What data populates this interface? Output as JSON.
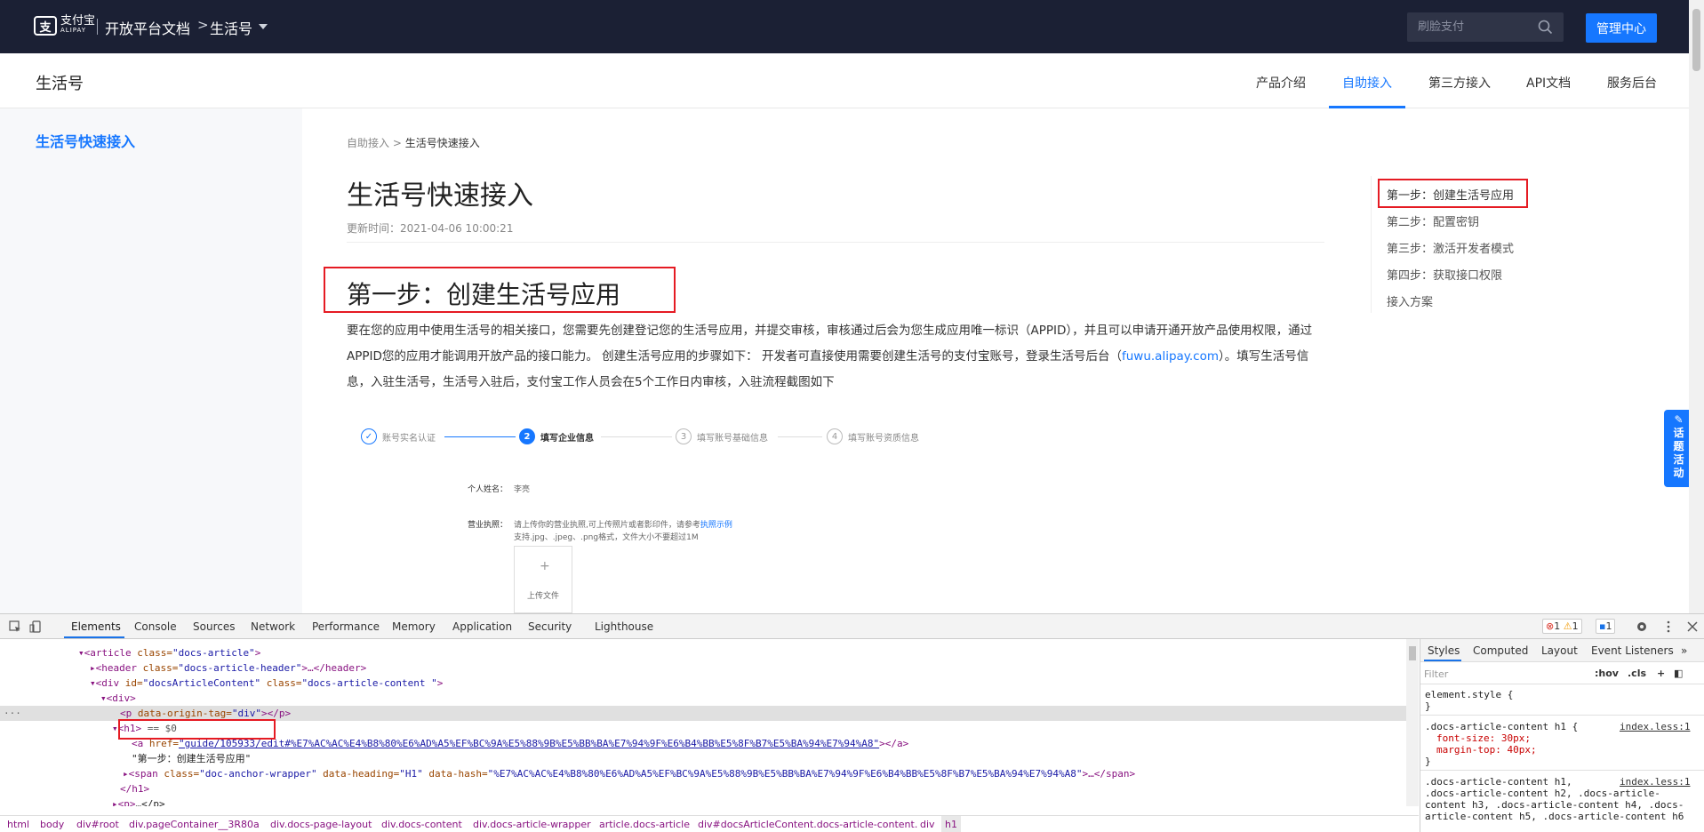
{
  "topbar": {
    "logo_cn": "支付宝",
    "logo_en": "ALIPAY",
    "title": "开放平台文档",
    "separator": ">",
    "product": "生活号",
    "search_placeholder": "刷脸支付",
    "admin_button": "管理中心"
  },
  "subnav": {
    "title": "生活号",
    "tabs": [
      {
        "label": "产品介绍"
      },
      {
        "label": "自助接入"
      },
      {
        "label": "第三方接入"
      },
      {
        "label": "API文档"
      },
      {
        "label": "服务后台"
      }
    ],
    "active_tab": "自助接入"
  },
  "sidebar": {
    "items": [
      {
        "label": "生活号快速接入"
      }
    ]
  },
  "breadcrumb": {
    "parent": "自助接入",
    "sep": ">",
    "current": "生活号快速接入"
  },
  "article": {
    "title": "生活号快速接入",
    "updated": "更新时间：2021-04-06 10:00:21",
    "h1": "第一步：创建生活号应用",
    "para_1": "要在您的应用中使用生活号的相关接口，您需要先创建登记您的生活号应用，并提交审核，审核通过后会为您生成应用唯一标识（APPID），并且可以申请开通开放产品使用权限，通过APPID您的应用才能调用开放产品的接口能力。 创建生活号应用的步骤如下： 开发者可直接使用需要创建生活号的支付宝账号，登录生活号后台（",
    "link": "fuwu.alipay.com",
    "para_2": "）。填写生活号信息，入驻生活号，生活号入驻后，支付宝工作人员会在5个工作日内审核，入驻流程截图如下"
  },
  "embedded_steps": {
    "steps": [
      {
        "num": "✓",
        "label": "账号实名认证"
      },
      {
        "num": "2",
        "label": "填写企业信息"
      },
      {
        "num": "3",
        "label": "填写账号基础信息"
      },
      {
        "num": "4",
        "label": "填写账号资质信息"
      }
    ],
    "name_label": "个人姓名：",
    "name_value": "李亮",
    "license_label": "营业执照：",
    "license_hint": "请上传你的营业执照,可上传照片或者影印件，请参考",
    "license_link": "执照示例",
    "license_formats": "支持.jpg、.jpeg、.png格式，文件大小不要超过1M",
    "upload_plus": "+",
    "upload_label": "上传文件"
  },
  "toc": {
    "items": [
      {
        "label": "第一步：创建生活号应用"
      },
      {
        "label": "第二步：配置密钥"
      },
      {
        "label": "第三步：激活开发者模式"
      },
      {
        "label": "第四步：获取接口权限"
      },
      {
        "label": "接入方案"
      }
    ]
  },
  "float_button": {
    "label": "话题活动"
  },
  "devtools": {
    "tabs": [
      {
        "label": "Elements"
      },
      {
        "label": "Console"
      },
      {
        "label": "Sources"
      },
      {
        "label": "Network"
      },
      {
        "label": "Performance"
      },
      {
        "label": "Memory"
      },
      {
        "label": "Application"
      },
      {
        "label": "Security"
      },
      {
        "label": "Lighthouse"
      }
    ],
    "errors": "1",
    "warnings": "1",
    "messages": "1",
    "dom": {
      "l1_tag": "<article",
      "l1_attr": " class=",
      "l1_val": "\"docs-article\"",
      "l2_tag": "<header",
      "l2_attr": " class=",
      "l2_val": "\"docs-article-header\"",
      "l2_tail": ">…</header>",
      "l3_tag": "<div",
      "l3_attr1": " id=",
      "l3_val1": "\"docsArticleContent\"",
      "l3_attr2": " class=",
      "l3_val2": "\"docs-article-content \"",
      "l4": "<div>",
      "l5_tag": "<p",
      "l5_attr": " data-origin-tag=",
      "l5_val": "\"div\"",
      "l5_tail": "></p>",
      "l6_tag": "<h1>",
      "l6_eq": " == $0",
      "l7_tag": "<a",
      "l7_attr": " href=",
      "l7_val": "\"guide/105933/edit#%E7%AC%AC%E4%B8%80%E6%AD%A5%EF%BC%9A%E5%88%9B%E5%BB%BA%E7%94%9F%E6%B4%BB%E5%8F%B7%E5%BA%94%E7%94%A8\"",
      "l7_tail": "></a>",
      "l8_text": "\"第一步：创建生活号应用\"",
      "l9_tag": "<span",
      "l9_attr1": " class=",
      "l9_val1": "\"doc-anchor-wrapper\"",
      "l9_attr2": " data-heading=",
      "l9_val2": "\"H1\"",
      "l9_attr3": " data-hash=",
      "l9_val3": "\"%E7%AC%AC%E4%B8%80%E6%AD%A5%EF%BC%9A%E5%88%9B%E5%BB%BA%E7%94%9F%E6%B4%BB%E5%8F%B7%E5%BA%94%E7%94%A8\"",
      "l9_tail": ">…</span>",
      "l10": "</h1>",
      "l11_tag": "<p>",
      "l11_tail": "…</p>"
    },
    "crumbs": [
      {
        "label": "html"
      },
      {
        "label": "body"
      },
      {
        "label": "div#root"
      },
      {
        "label": "div.pageContainer__3R80a"
      },
      {
        "label": "div.docs-page-layout"
      },
      {
        "label": "div.docs-content"
      },
      {
        "label": "div.docs-article-wrapper"
      },
      {
        "label": "article.docs-article"
      },
      {
        "label": "div#docsArticleContent.docs-article-content."
      },
      {
        "label": "div"
      },
      {
        "label": "h1"
      }
    ],
    "styles_tabs": [
      {
        "label": "Styles"
      },
      {
        "label": "Computed"
      },
      {
        "label": "Layout"
      },
      {
        "label": "Event Listeners"
      }
    ],
    "filter_placeholder": "Filter",
    "hov": ":hov",
    "cls": ".cls",
    "styles": {
      "element_style": "element.style {",
      "close1": "}",
      "rule1_sel": ".docs-article-content h1 {",
      "rule1_link": "index.less:1",
      "rule1_p1": "font-size: 30px;",
      "rule1_p2": "margin-top: 40px;",
      "close2": "}",
      "rule2_l1": ".docs-article-content h1,",
      "rule2_link": "index.less:1",
      "rule2_l2": ".docs-article-content h2, .docs-article-",
      "rule2_l3": "content h3, .docs-article-content h4, .docs-",
      "rule2_l4": "article-content h5, .docs-article-content h6"
    }
  }
}
